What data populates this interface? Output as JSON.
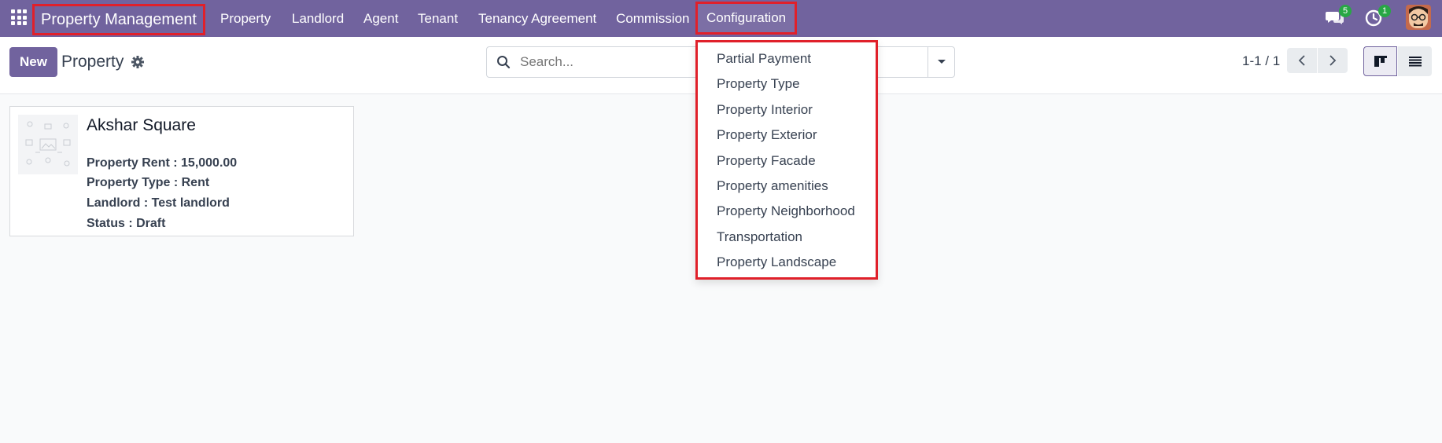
{
  "navbar": {
    "brand": "Property Management",
    "menus": [
      "Property",
      "Landlord",
      "Agent",
      "Tenant",
      "Tenancy Agreement",
      "Commission"
    ],
    "config_label": "Configuration",
    "messages_badge": "5",
    "activities_badge": "1",
    "bg_color": "#71639e"
  },
  "control": {
    "new_label": "New",
    "breadcrumb": "Property",
    "search_placeholder": "Search...",
    "pager": "1-1 / 1"
  },
  "card": {
    "title": "Akshar Square",
    "fields": [
      "Property Rent : 15,000.00",
      "Property Type : Rent",
      "Landlord : Test landlord",
      "Status : Draft"
    ]
  },
  "dropdown": {
    "items": [
      "Partial Payment",
      "Property Type",
      "Property Interior",
      "Property Exterior",
      "Property Facade",
      "Property amenities",
      "Property Neighborhood",
      "Transportation",
      "Property Landscape"
    ]
  }
}
